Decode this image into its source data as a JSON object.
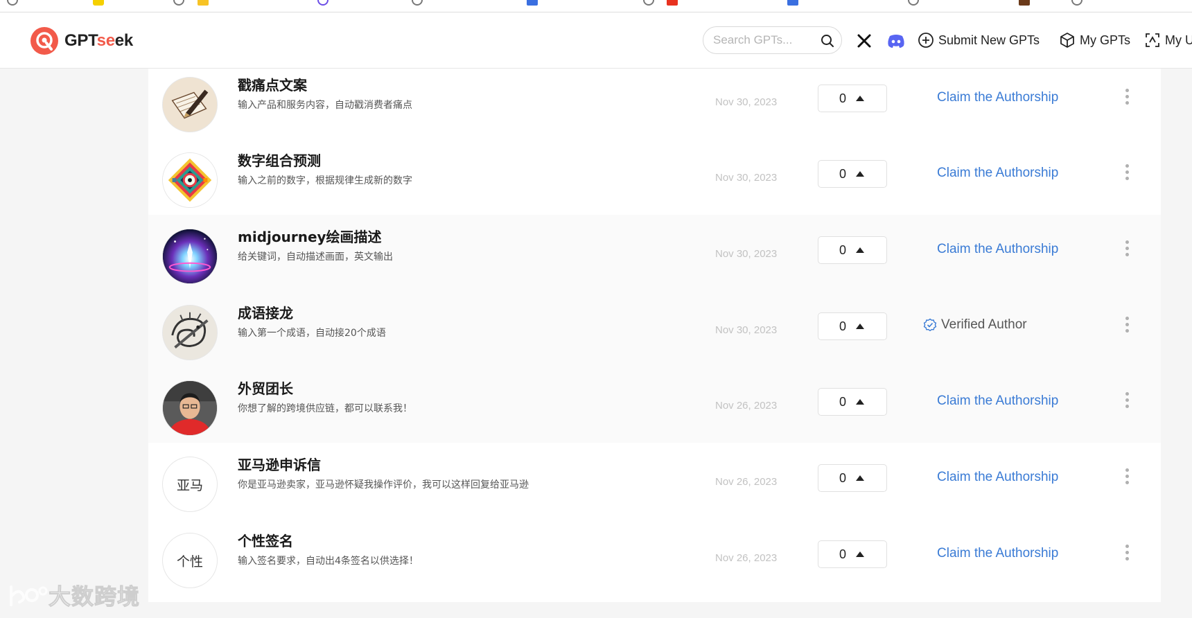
{
  "header": {
    "logo": {
      "text_a": "GPT",
      "text_b": "se",
      "text_c": "ek"
    },
    "search": {
      "placeholder": "Search GPTs..."
    },
    "nav": {
      "submit_label": "Submit New GPTs",
      "my_gpts_label": "My GPTs",
      "my_u_label": "My U"
    }
  },
  "gpts": [
    {
      "title": "戳痛点文案",
      "description": "输入产品和服务内容，自动戳消费者痛点",
      "date": "Nov 30, 2023",
      "votes": "0",
      "action": "Claim the Authorship",
      "avatar": "pen-paper"
    },
    {
      "title": "数字组合预测",
      "description": "输入之前的数字，根据规律生成新的数字",
      "date": "Nov 30, 2023",
      "votes": "0",
      "action": "Claim the Authorship",
      "avatar": "colorful-pattern"
    },
    {
      "title": "midjourney绘画描述",
      "description": "给关键词，自动描述画面，英文输出",
      "date": "Nov 30, 2023",
      "votes": "0",
      "action": "Claim the Authorship",
      "avatar": "cosmic-figure"
    },
    {
      "title": "成语接龙",
      "description": "输入第一个成语，自动接20个成语",
      "date": "Nov 30, 2023",
      "votes": "0",
      "action": "Verified Author",
      "avatar": "dragon-sketch"
    },
    {
      "title": "外贸团长",
      "description": "你想了解的跨境供应链，都可以联系我！",
      "date": "Nov 26, 2023",
      "votes": "0",
      "action": "Claim the Authorship",
      "avatar": "person-photo"
    },
    {
      "title": "亚马逊申诉信",
      "description": "你是亚马逊卖家，亚马逊怀疑我操作评价，我可以这样回复给亚马逊",
      "date": "Nov 26, 2023",
      "votes": "0",
      "action": "Claim the Authorship",
      "avatar_text": "亚马"
    },
    {
      "title": "个性签名",
      "description": "输入签名要求，自动出4条签名以供选择！",
      "date": "Nov 26, 2023",
      "votes": "0",
      "action": "Claim the Authorship",
      "avatar_text": "个性"
    }
  ],
  "watermark": {
    "text": "大数跨境"
  },
  "colors": {
    "brand": "#f25a4a",
    "link": "#3a7bd5",
    "discord": "#5865f2"
  }
}
